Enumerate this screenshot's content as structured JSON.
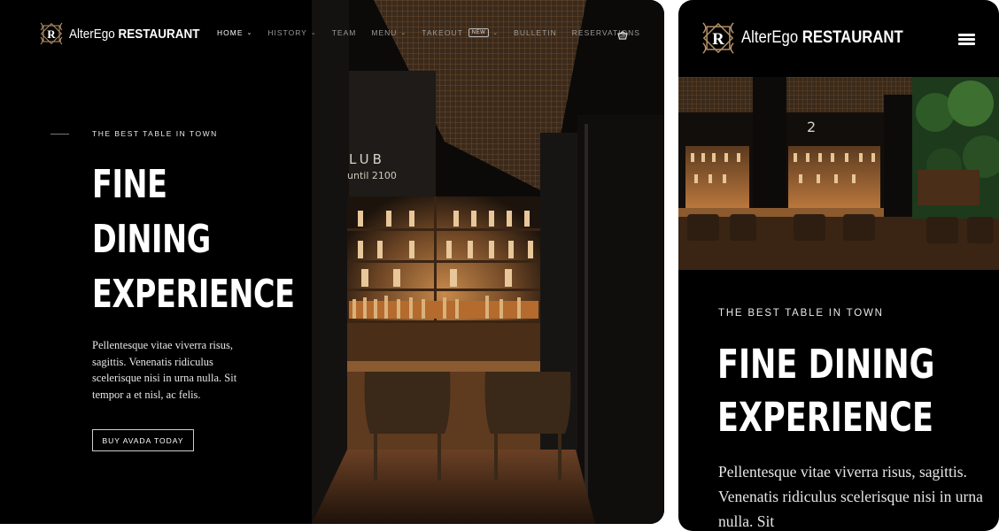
{
  "brand": {
    "monogram": "R",
    "name_light": "AlterEgo",
    "name_bold": "RESTAURANT"
  },
  "nav": {
    "items": [
      {
        "label": "HOME",
        "dropdown": true,
        "active": true
      },
      {
        "label": "HISTORY",
        "dropdown": true,
        "active": false
      },
      {
        "label": "TEAM",
        "dropdown": false,
        "active": false
      },
      {
        "label": "MENU",
        "dropdown": true,
        "active": false
      },
      {
        "label": "TAKEOUT",
        "dropdown": true,
        "active": false,
        "badge": "NEW"
      },
      {
        "label": "BULLETIN",
        "dropdown": false,
        "active": false
      },
      {
        "label": "RESERVATIONS",
        "dropdown": false,
        "active": false
      }
    ],
    "cart_icon": "basket-icon",
    "menu_icon": "hamburger-icon"
  },
  "hero": {
    "eyebrow": "THE BEST TABLE IN TOWN",
    "headline_desktop": [
      "FINE",
      "DINING",
      "EXPERIENCE"
    ],
    "headline_mobile": [
      "FINE DINING",
      "EXPERIENCE"
    ],
    "body": "Pellentesque vitae viverra risus, sagittis. Venenatis ridiculus scelerisque nisi in urna nulla. Sit tempor a et nisl, ac felis.",
    "body_mobile_visible": "Pellentesque vitae viverra risus, sagittis. Venenatis ridiculus scelerisque nisi in urna nulla. Sit",
    "cta_label": "BUY AVADA TODAY"
  },
  "photo": {
    "sign_line1": "LUB",
    "sign_line2": "until 2100",
    "mobile_sign": "2"
  },
  "colors": {
    "background": "#000000",
    "text": "#ffffff",
    "muted_nav": "#9a9a9a",
    "warm_glow": "#c8894a"
  }
}
